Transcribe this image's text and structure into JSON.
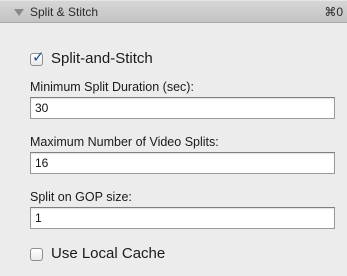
{
  "panel": {
    "title": "Split & Stitch",
    "shortcut": "⌘0"
  },
  "split_and_stitch": {
    "label": "Split-and-Stitch",
    "checked": true
  },
  "min_split_duration": {
    "label": "Minimum Split Duration (sec):",
    "value": "30"
  },
  "max_video_splits": {
    "label": "Maximum Number of Video Splits:",
    "value": "16"
  },
  "split_gop_size": {
    "label": "Split on GOP size:",
    "value": "1"
  },
  "use_local_cache": {
    "label": "Use Local Cache",
    "checked": false
  },
  "colors": {
    "panel_background": "#ececec",
    "checkmark": "#1f4e96"
  }
}
